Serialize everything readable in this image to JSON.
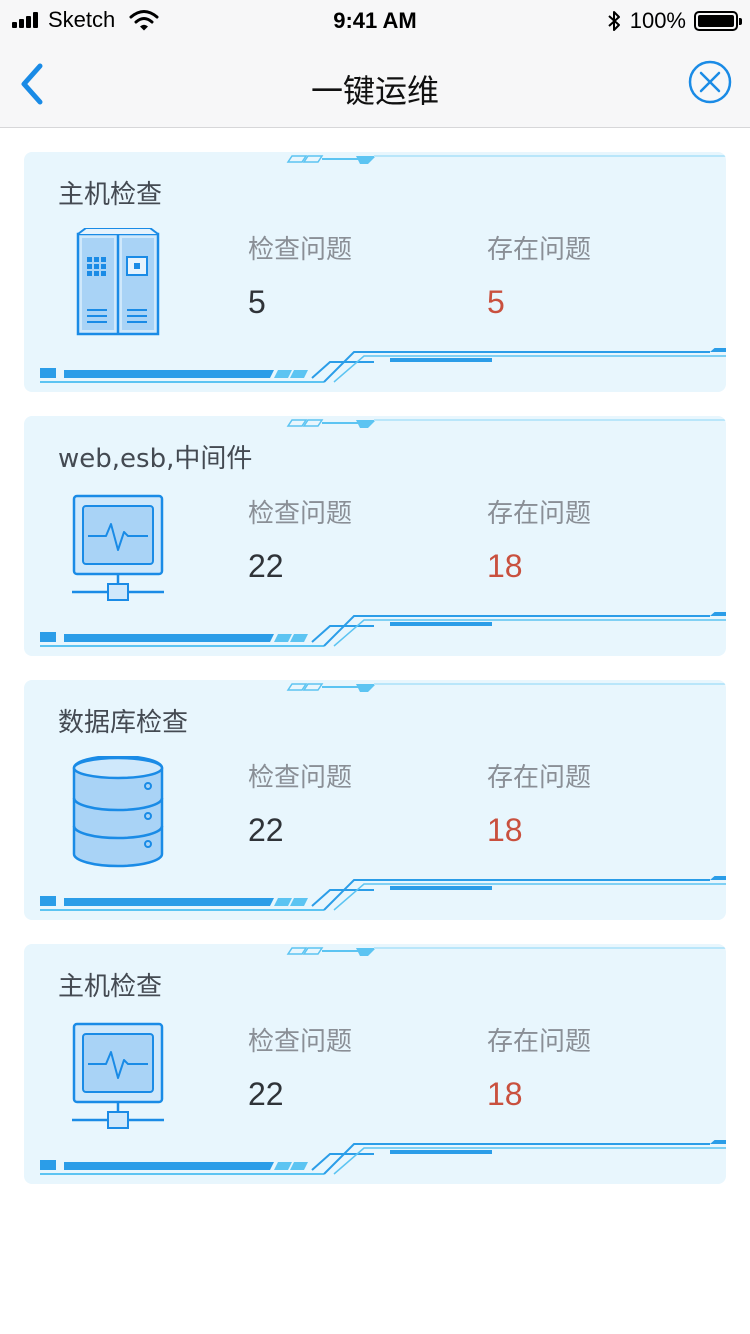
{
  "status_bar": {
    "carrier": "Sketch",
    "time": "9:41 AM",
    "battery": "100%"
  },
  "nav": {
    "title": "一键运维"
  },
  "colors": {
    "accent": "#1a8be6",
    "card_bg": "#e8f6fd",
    "problem_value": "#c9503e"
  },
  "cards": [
    {
      "title": "主机检查",
      "icon": "server-cabinet-icon",
      "check_label": "检查问题",
      "check_value": "5",
      "exist_label": "存在问题",
      "exist_value": "5"
    },
    {
      "title": "web,esb,中间件",
      "icon": "monitor-network-icon",
      "check_label": "检查问题",
      "check_value": "22",
      "exist_label": "存在问题",
      "exist_value": "18"
    },
    {
      "title": "数据库检查",
      "icon": "database-icon",
      "check_label": "检查问题",
      "check_value": "22",
      "exist_label": "存在问题",
      "exist_value": "18"
    },
    {
      "title": "主机检查",
      "icon": "monitor-network-icon",
      "check_label": "检查问题",
      "check_value": "22",
      "exist_label": "存在问题",
      "exist_value": "18"
    }
  ]
}
